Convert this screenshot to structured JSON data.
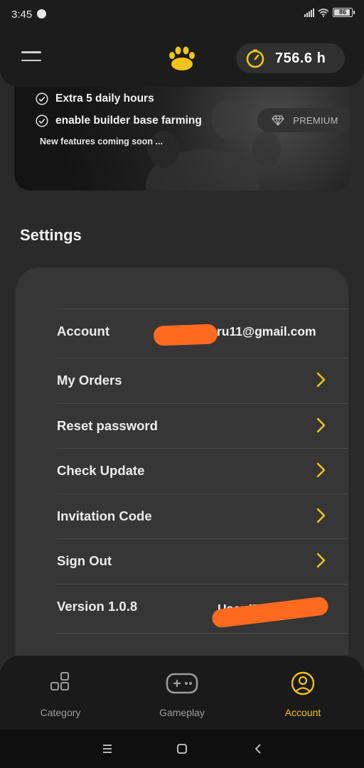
{
  "status_bar": {
    "time": "3:45",
    "battery": "86"
  },
  "header": {
    "timer_value": "756.6 h"
  },
  "banner": {
    "benefits": [
      "Extra 5 daily hours",
      "enable builder base farming"
    ],
    "coming_soon": "New features coming soon ...",
    "premium_label": "PREMIUM"
  },
  "settings": {
    "title": "Settings",
    "account": {
      "label": "Account",
      "value_visible": "ru11@gmail.com"
    },
    "items": [
      {
        "label": "My Orders"
      },
      {
        "label": "Reset password"
      },
      {
        "label": "Check Update"
      },
      {
        "label": "Invitation Code"
      },
      {
        "label": "Sign Out"
      }
    ],
    "version": {
      "label": "Version 1.0.8",
      "user_id_label": "User ID"
    }
  },
  "bottom_nav": {
    "items": [
      {
        "label": "Category",
        "icon": "category-icon",
        "active": false
      },
      {
        "label": "Gameplay",
        "icon": "gamepad-icon",
        "active": false
      },
      {
        "label": "Account",
        "icon": "account-icon",
        "active": true
      }
    ]
  },
  "colors": {
    "accent": "#f0c419",
    "background": "#2a2a2a",
    "card": "#363636",
    "redaction": "#ff6a1f"
  }
}
